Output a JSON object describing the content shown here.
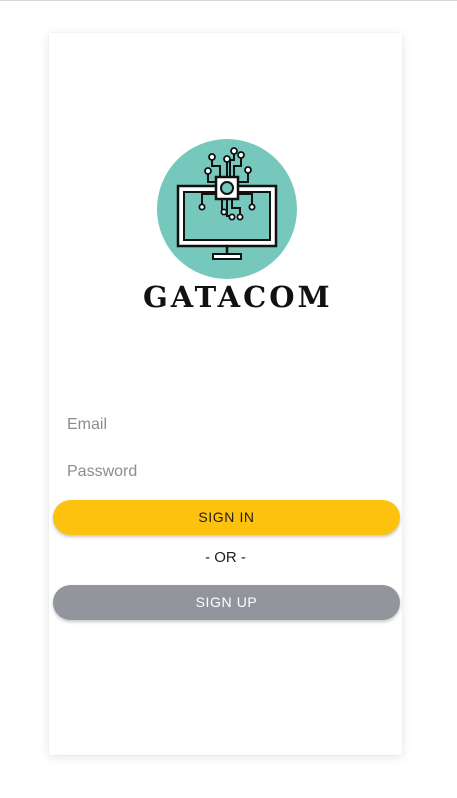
{
  "brand": {
    "name": "GATACOM",
    "logo_icon": "computer-circuit-logo-icon",
    "logo_circle_color": "#76c8bc"
  },
  "form": {
    "email_placeholder": "Email",
    "password_placeholder": "Password",
    "signin_label": "SIGN IN",
    "separator": "- OR -",
    "signup_label": "SIGN UP"
  },
  "colors": {
    "signin": "#fcc20d",
    "signup": "#93959c"
  }
}
